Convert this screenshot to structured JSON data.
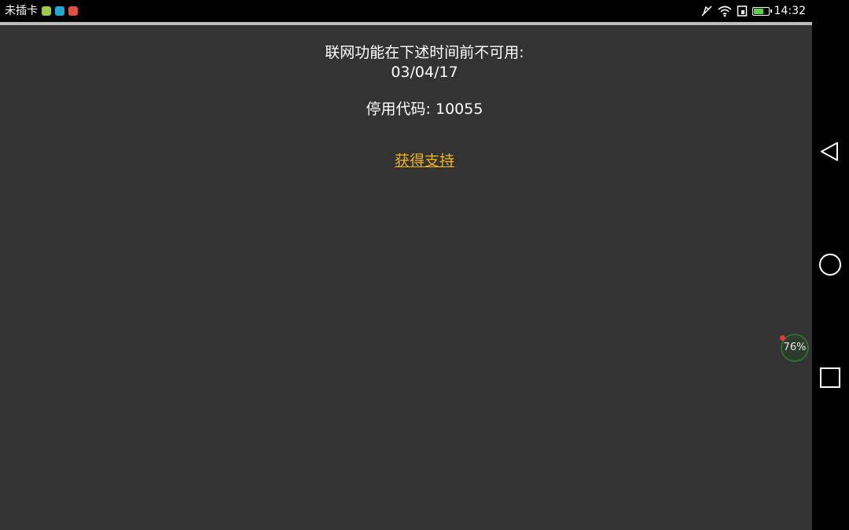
{
  "status_bar": {
    "carrier": "未插卡",
    "time": "14:32",
    "app_icons": [
      {
        "name": "app-icon-1",
        "color": "#9bc84a"
      },
      {
        "name": "app-icon-2",
        "color": "#22a7d6"
      },
      {
        "name": "app-icon-3",
        "color": "#e0523f"
      }
    ],
    "battery_level_percent": 60
  },
  "notice": {
    "line1": "联网功能在下述时间前不可用:",
    "date": "03/04/17",
    "code_line": "停用代码: 10055",
    "support_link": "获得支持"
  },
  "float_widget": {
    "label": "76%"
  },
  "colors": {
    "background": "#333333",
    "link": "#f0b21a",
    "text": "#ffffff"
  }
}
